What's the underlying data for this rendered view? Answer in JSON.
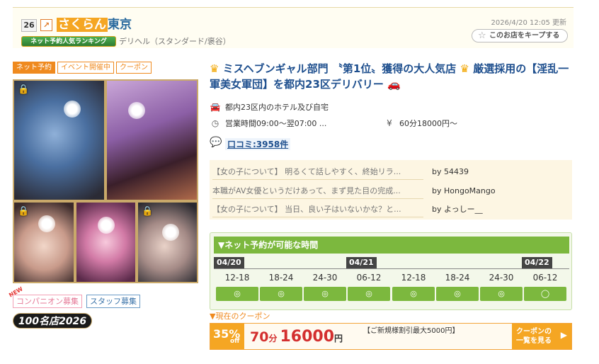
{
  "header": {
    "rank": "26",
    "rank_arrow": "↗",
    "name_highlight": "さくらん",
    "name_rest": "東京",
    "ranking_badge": "ネット予約人気ランキング",
    "genre": "デリヘル（スタンダード/褒谷）",
    "updated": "2026/4/20 12:05 更新",
    "keep_label": "このお店をキープする"
  },
  "tags": [
    "ネット予約",
    "イベント開催中",
    "クーポン"
  ],
  "recruit": {
    "new_label": "NEW",
    "companion": "コンパニオン募集",
    "staff": "スタッフ募集"
  },
  "meiten_badge": "100名店2026",
  "catch": {
    "text": "ミスヘブンギャル部門 〝第1位〟獲得の大人気店",
    "text2": "厳選採用の【淫乱一軍美女軍団】を都内23区デリバリー"
  },
  "info": {
    "area": "都内23区内のホテル及び自宅",
    "hours": "営業時間09:00～翌07:00 ...",
    "price": "60分18000円～"
  },
  "reviews": {
    "link": "口コミ:3958件",
    "items": [
      {
        "text": "【女の子について】 明るくて話しやすく、終始リラ...",
        "by": "by 54439"
      },
      {
        "text": "本職がAV女優というだけあって、まず見た目の完成...",
        "by": "by HongoMango"
      },
      {
        "text": "【女の子について】 当日、良い子はいないかな？と...",
        "by": "by よっしー__"
      }
    ]
  },
  "reservation": {
    "header": "▼ネット予約が可能な時間",
    "dates": [
      "04/20",
      "04/21",
      "04/22"
    ],
    "slots": [
      {
        "label": "12-18",
        "mark": "◎"
      },
      {
        "label": "18-24",
        "mark": "◎"
      },
      {
        "label": "24-30",
        "mark": "◎"
      },
      {
        "label": "06-12",
        "mark": "◎"
      },
      {
        "label": "12-18",
        "mark": "◎"
      },
      {
        "label": "18-24",
        "mark": "◎"
      },
      {
        "label": "24-30",
        "mark": "◎"
      },
      {
        "label": "06-12",
        "mark": "◯"
      }
    ]
  },
  "coupon": {
    "title": "▼現在のクーポン",
    "pct": "35%",
    "off": "off",
    "minutes": "70",
    "minutes_unit": "分",
    "price": "16000",
    "price_unit": "円",
    "desc": "【ご新規様割引最大5000円】",
    "more_line1": "クーポンの",
    "more_line2": "一覧を見る",
    "more_arrow": "▶"
  },
  "icons": {
    "lock": "lock-icon",
    "star": "star-icon",
    "car": "car-icon",
    "clock": "clock-icon",
    "yen": "yen-icon",
    "chat": "chat-icon",
    "crown": "crown-icon"
  },
  "colors": {
    "accent_orange": "#ef8a1f",
    "link_blue": "#1e4f8e",
    "green": "#7cb83e"
  }
}
